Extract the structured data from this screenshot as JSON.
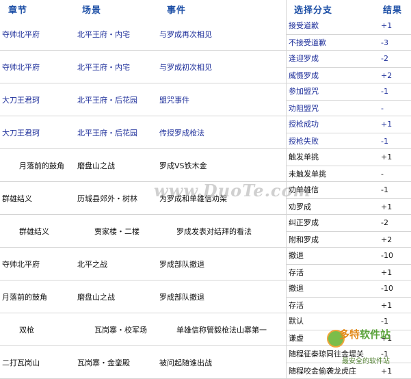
{
  "headers": [
    "章节",
    "场景",
    "事件",
    "选择分支",
    "结果"
  ],
  "rows": [
    {
      "chapter": "夺帅北平府",
      "scene": "北平王府・内宅",
      "event": "与罗成再次相见",
      "color": "blue",
      "options": [
        {
          "label": "接受道歉",
          "value": "+1"
        },
        {
          "label": "不接受道歉",
          "value": "-3"
        }
      ]
    },
    {
      "chapter": "夺帅北平府",
      "scene": "北平王府・内宅",
      "event": "与罗成初次相见",
      "color": "blue",
      "options": [
        {
          "label": "逢迎罗成",
          "value": "-2"
        },
        {
          "label": "威慑罗成",
          "value": "+2"
        }
      ]
    },
    {
      "chapter": "大刀王君珂",
      "scene": "北平王府・后花园",
      "event": "盟咒事件",
      "color": "blue",
      "options": [
        {
          "label": "参加盟咒",
          "value": "-1"
        },
        {
          "label": "劝阻盟咒",
          "value": "-"
        }
      ]
    },
    {
      "chapter": "大刀王君珂",
      "scene": "北平王府・后花园",
      "event": "传授罗成枪法",
      "color": "blue",
      "options": [
        {
          "label": "授枪成功",
          "value": "+1"
        },
        {
          "label": "授枪失败",
          "value": "-1"
        }
      ]
    },
    {
      "chapter": "月落前的鼓角",
      "scene": "磨盘山之战",
      "event": "罗成VS铁木金",
      "color": "black",
      "options": [
        {
          "label": "触发单挑",
          "value": "+1"
        },
        {
          "label": "未触发单挑",
          "value": "-"
        }
      ]
    },
    {
      "chapter": "群雄结义",
      "scene": "历城县郊外・树林",
      "event": "为罗成和单雄信劝架",
      "color": "black",
      "options": [
        {
          "label": "劝单雄信",
          "value": "-1"
        },
        {
          "label": "劝罗成",
          "value": "+1"
        }
      ]
    },
    {
      "chapter": "群雄结义",
      "scene": "贾家楼・二楼",
      "event": "罗成发表对结拜的看法",
      "color": "black",
      "options": [
        {
          "label": "纠正罗成",
          "value": "-2"
        },
        {
          "label": "附和罗成",
          "value": "+2"
        }
      ]
    },
    {
      "chapter": "夺帅北平府",
      "scene": "北平之战",
      "event": "罗成部队撤退",
      "color": "black",
      "options": [
        {
          "label": "撤退",
          "value": "-10"
        },
        {
          "label": "存活",
          "value": "+1"
        }
      ]
    },
    {
      "chapter": "月落前的鼓角",
      "scene": "磨盘山之战",
      "event": "罗成部队撤退",
      "color": "black",
      "options": [
        {
          "label": "撤退",
          "value": "-10"
        },
        {
          "label": "存活",
          "value": "+1"
        }
      ]
    },
    {
      "chapter": "双枪",
      "scene": "瓦岗寨・校军场",
      "event": "单雄信称管毅枪法山寨第一",
      "color": "black",
      "options": [
        {
          "label": "默认",
          "value": "-1"
        },
        {
          "label": "谦虚",
          "value": "+1"
        }
      ]
    },
    {
      "chapter": "二打瓦岗山",
      "scene": "瓦岗寨・金銮殿",
      "event": "被问起随谁出战",
      "color": "black",
      "options": [
        {
          "label": "随程征秦琼同往金堤关",
          "value": "-1"
        },
        {
          "label": "随程咬金偷袭龙虎庄",
          "value": "+1"
        }
      ]
    }
  ],
  "watermark": {
    "site": "www.DuoTe.com",
    "logo_a": "多特",
    "logo_b": "软件站",
    "sub": "最安全的软件站"
  }
}
